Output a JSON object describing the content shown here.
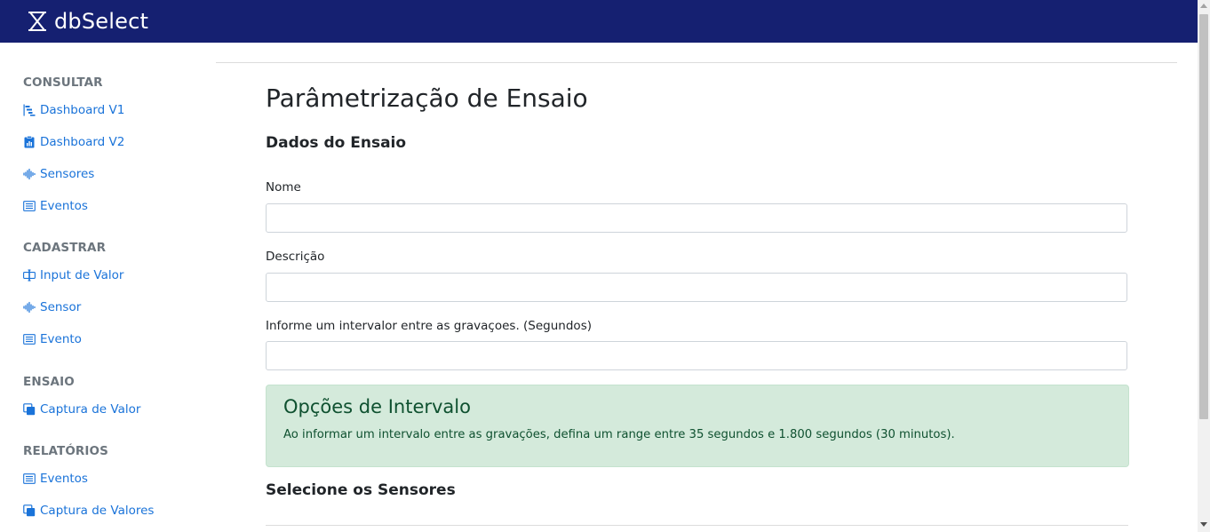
{
  "app": {
    "name": "dbSelect"
  },
  "sidebar": {
    "sections": [
      {
        "title": "CONSULTAR",
        "items": [
          {
            "label": "Dashboard V1",
            "icon": "bar-chart-steps-icon"
          },
          {
            "label": "Dashboard V2",
            "icon": "clipboard-data-icon"
          },
          {
            "label": "Sensores",
            "icon": "soundwave-icon"
          },
          {
            "label": "Eventos",
            "icon": "list-icon"
          }
        ]
      },
      {
        "title": "CADASTRAR",
        "items": [
          {
            "label": "Input de Valor",
            "icon": "input-cursor-icon"
          },
          {
            "label": "Sensor",
            "icon": "soundwave-icon"
          },
          {
            "label": "Evento",
            "icon": "list-icon"
          }
        ]
      },
      {
        "title": "ENSAIO",
        "items": [
          {
            "label": "Captura de Valor",
            "icon": "copy-icon"
          }
        ]
      },
      {
        "title": "RELATÓRIOS",
        "items": [
          {
            "label": "Eventos",
            "icon": "list-icon"
          },
          {
            "label": "Captura de Valores",
            "icon": "copy-icon"
          }
        ]
      }
    ]
  },
  "main": {
    "title": "Parâmetrização de Ensaio",
    "section_title": "Dados do Ensaio",
    "fields": [
      {
        "label": "Nome",
        "value": "",
        "placeholder": ""
      },
      {
        "label": "Descrição",
        "value": "",
        "placeholder": ""
      },
      {
        "label": "Informe um intervalor entre as gravaçoes. (Segundos)",
        "value": "",
        "placeholder": ""
      }
    ],
    "alert": {
      "title": "Opções de Intervalo",
      "text": "Ao informar um intervalo entre as gravações, defina um range entre 35 segundos e 1.800 segundos (30 minutos)."
    },
    "sensors_title": "Selecione os Sensores"
  },
  "colors": {
    "header_bg": "#152071",
    "link": "#1a73d9",
    "section_title": "#6c757d",
    "alert_bg": "#d4eadb",
    "alert_text": "#0f5130"
  }
}
